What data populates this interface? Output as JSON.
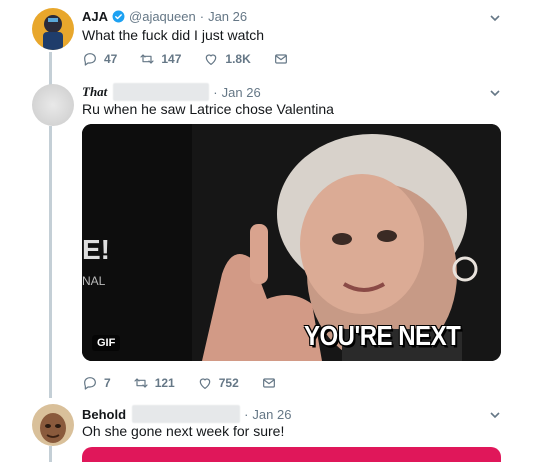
{
  "colors": {
    "accent": "#1da1f2",
    "text": "#14171a",
    "muted": "#657786",
    "thread": "#c4cfd6",
    "media_bottom": "#e0175a"
  },
  "tweets": [
    {
      "name": "AJA",
      "handle": "@ajaqueen",
      "separator": "·",
      "date": "Jan 26",
      "text": "What the fuck did I just watch",
      "verified": true,
      "stats": {
        "replies": "47",
        "retweets": "147",
        "likes": "1.8K"
      }
    },
    {
      "name": "That",
      "separator": "·",
      "date": "Jan 26",
      "text": "Ru when he saw Latrice chose Valentina",
      "media": {
        "badge": "GIF",
        "caption": "YOU'RE NEXT",
        "logo": "E!",
        "logo_sub": "NAL"
      },
      "stats": {
        "replies": "7",
        "retweets": "121",
        "likes": "752"
      }
    },
    {
      "name": "Behold",
      "separator": "·",
      "date": "Jan 26",
      "text": "Oh she gone next week for sure!"
    }
  ],
  "icons": [
    "reply-icon",
    "retweet-icon",
    "like-icon",
    "message-icon",
    "chevron-down-icon",
    "verified-icon"
  ]
}
